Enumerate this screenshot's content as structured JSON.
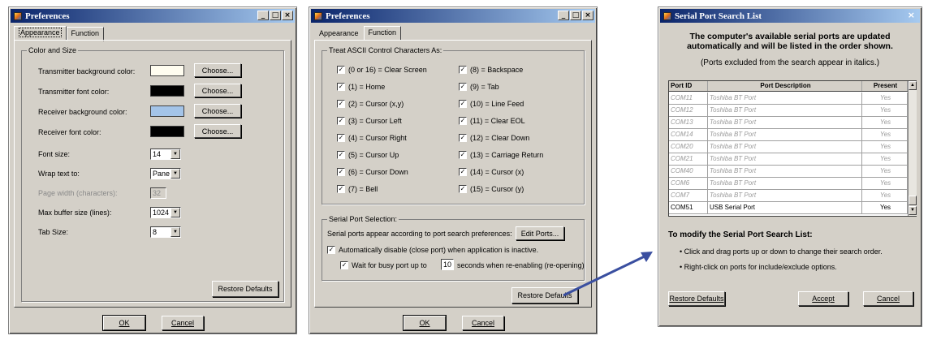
{
  "dialog_appearance": {
    "title": "Preferences",
    "tabs": [
      "Appearance",
      "Function"
    ],
    "group_title": "Color and Size",
    "rows": [
      {
        "label": "Transmitter background color:",
        "button": "Choose...",
        "color": "#fffdf0"
      },
      {
        "label": "Transmitter font color:",
        "button": "Choose...",
        "color": "#000000"
      },
      {
        "label": "Receiver background color:",
        "button": "Choose...",
        "color": "#a4c4e8"
      },
      {
        "label": "Receiver font color:",
        "button": "Choose...",
        "color": "#000000"
      }
    ],
    "font_size_label": "Font size:",
    "font_size_value": "14",
    "wrap_label": "Wrap text to:",
    "wrap_value": "Pane",
    "page_width_label": "Page width (characters):",
    "page_width_value": "32",
    "buffer_label": "Max buffer size (lines):",
    "buffer_value": "1024",
    "tab_label": "Tab Size:",
    "tab_value": "8",
    "restore": "Restore Defaults",
    "ok": "OK",
    "cancel": "Cancel"
  },
  "dialog_function": {
    "title": "Preferences",
    "tabs": [
      "Appearance",
      "Function"
    ],
    "group_title": "Treat ASCII Control Characters As:",
    "left_items": [
      "(0 or 16) = Clear Screen",
      "(1) = Home",
      "(2) = Cursor (x,y)",
      "(3) = Cursor Left",
      "(4) = Cursor Right",
      "(5) = Cursor Up",
      "(6) = Cursor Down",
      "(7) = Bell"
    ],
    "right_items": [
      "(8) = Backspace",
      "(9) = Tab",
      "(10) = Line Feed",
      "(11) = Clear EOL",
      "(12) = Clear Down",
      "(13) = Carriage Return",
      "(14) = Cursor (x)",
      "(15) = Cursor (y)"
    ],
    "serial_group_title": "Serial Port Selection:",
    "serial_text": "Serial ports appear according to port search preferences:",
    "edit_ports": "Edit Ports...",
    "auto_disable": "Automatically disable (close port) when application is inactive.",
    "wait_prefix": "Wait for busy port up to",
    "wait_value": "10",
    "wait_suffix": "seconds when re-enabling (re-opening)",
    "restore": "Restore Defaults",
    "ok": "OK",
    "cancel": "Cancel"
  },
  "dialog_serial": {
    "title": "Serial Port Search List",
    "heading_line1": "The computer's available serial ports are updated",
    "heading_line2": "automatically and will be listed in the order shown.",
    "subheading": "(Ports excluded from the search appear in italics.)",
    "columns": [
      "Port ID",
      "Port Description",
      "Present"
    ],
    "rows": [
      {
        "id": "COM11",
        "desc": "Toshiba BT Port",
        "present": "Yes",
        "excluded": true
      },
      {
        "id": "COM12",
        "desc": "Toshiba BT Port",
        "present": "Yes",
        "excluded": true
      },
      {
        "id": "COM13",
        "desc": "Toshiba BT Port",
        "present": "Yes",
        "excluded": true
      },
      {
        "id": "COM14",
        "desc": "Toshiba BT Port",
        "present": "Yes",
        "excluded": true
      },
      {
        "id": "COM20",
        "desc": "Toshiba BT Port",
        "present": "Yes",
        "excluded": true
      },
      {
        "id": "COM21",
        "desc": "Toshiba BT Port",
        "present": "Yes",
        "excluded": true
      },
      {
        "id": "COM40",
        "desc": "Toshiba BT Port",
        "present": "Yes",
        "excluded": true
      },
      {
        "id": "COM6",
        "desc": "Toshiba BT Port",
        "present": "Yes",
        "excluded": true
      },
      {
        "id": "COM7",
        "desc": "Toshiba BT Port",
        "present": "Yes",
        "excluded": true
      },
      {
        "id": "COM51",
        "desc": "USB Serial Port",
        "present": "Yes",
        "excluded": false
      }
    ],
    "modify_title": "To modify the Serial Port Search List:",
    "bullet1": "• Click and drag ports up or down to change their search order.",
    "bullet2": "• Right-click on ports for include/exclude options.",
    "restore": "Restore Defaults",
    "accept": "Accept",
    "cancel": "Cancel"
  },
  "arrow_color": "#3a4fa0"
}
